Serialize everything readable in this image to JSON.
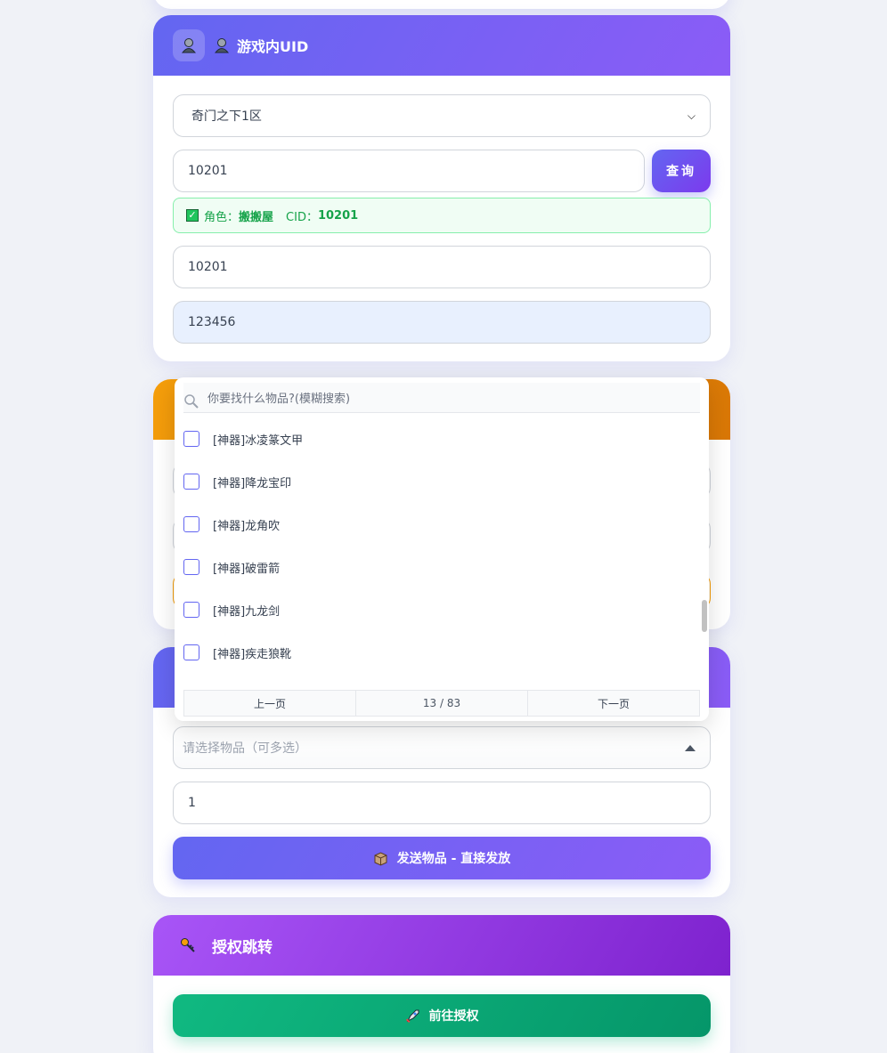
{
  "uid_card": {
    "title": "游戏内UID",
    "server_select": "奇门之下1区",
    "uid_input": "10201",
    "query_button": "查询",
    "result": {
      "role_label": "角色：",
      "role_name": "搬搬屋",
      "cid_label": "CID：",
      "cid_value": "10201"
    },
    "field_3": "10201",
    "field_4": "123456"
  },
  "item_dropdown": {
    "search_placeholder": "你要找什么物品?(模糊搜索)",
    "items": [
      {
        "label": "[神器]冰凌篆文甲"
      },
      {
        "label": "[神器]降龙宝印"
      },
      {
        "label": "[神器]龙角吹"
      },
      {
        "label": "[神器]破雷箭"
      },
      {
        "label": "[神器]九龙剑"
      },
      {
        "label": "[神器]疾走狼靴"
      }
    ],
    "pager": {
      "prev": "上一页",
      "page": "13 / 83",
      "next": "下一页"
    }
  },
  "send_card": {
    "select_placeholder": "请选择物品（可多选）",
    "quantity": "1",
    "send_button": "发送物品 - 直接发放"
  },
  "auth_card": {
    "title": "授权跳转",
    "go_button": "前往授权"
  },
  "icons": {
    "uid": "person-icon",
    "package": "package-icon",
    "key": "key-icon",
    "rocket": "rocket-icon",
    "search": "search-icon"
  },
  "colors": {
    "primary": "#6366f1",
    "orange": "#f59e0b",
    "purple": "#a855f7",
    "green": "#10b981",
    "success": "#16a34a"
  }
}
